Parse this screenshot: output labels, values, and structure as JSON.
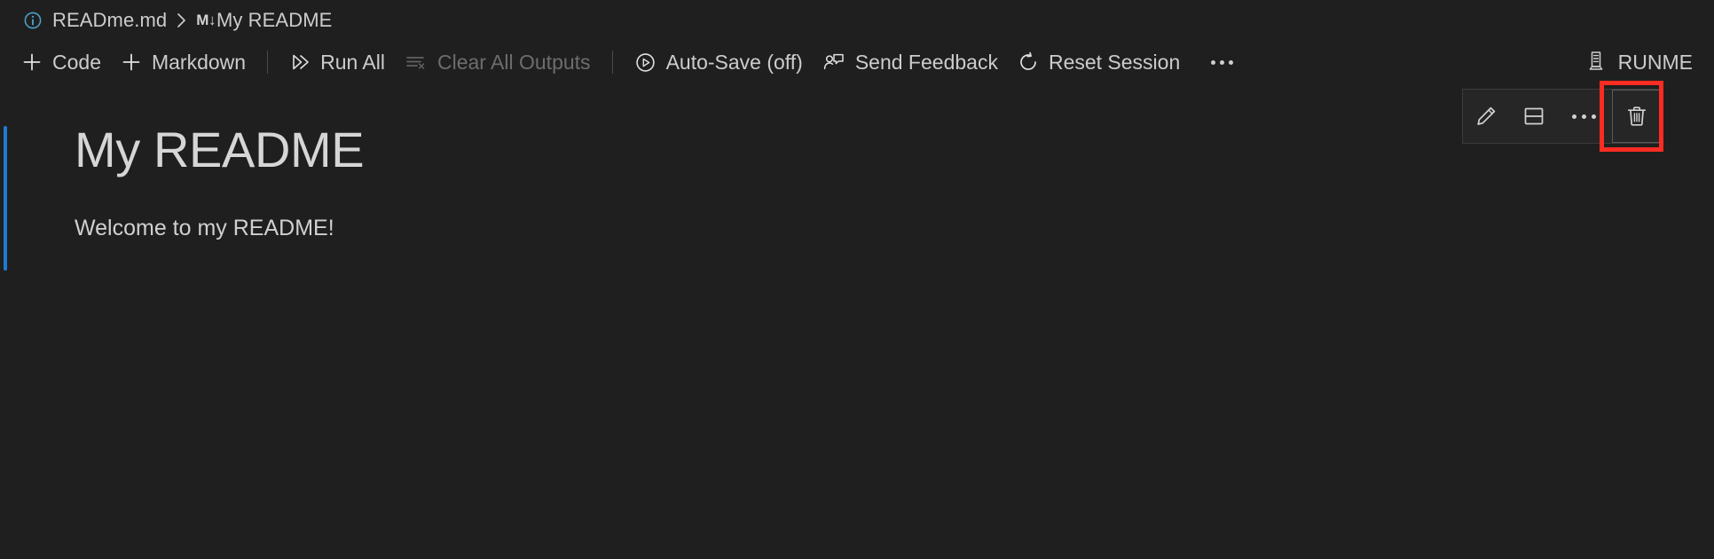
{
  "breadcrumb": {
    "info_icon": "info-icon",
    "file": "READme.md",
    "separator": "›",
    "markdown_icon_letter": "M",
    "markdown_icon_arrow": "↓",
    "heading": "My README"
  },
  "toolbar": {
    "add_code": {
      "label": "Code",
      "icon": "plus-icon"
    },
    "add_markdown": {
      "label": "Markdown",
      "icon": "plus-icon"
    },
    "run_all": {
      "label": "Run All",
      "icon": "run-all-icon"
    },
    "clear_all_outputs": {
      "label": "Clear All Outputs",
      "icon": "clear-outputs-icon",
      "disabled": true
    },
    "auto_save": {
      "label": "Auto-Save (off)",
      "icon": "play-circle-icon"
    },
    "send_feedback": {
      "label": "Send Feedback",
      "icon": "feedback-icon"
    },
    "reset_session": {
      "label": "Reset Session",
      "icon": "refresh-icon"
    },
    "overflow": {
      "label": "…",
      "icon": "ellipsis-icon"
    },
    "kernel": {
      "label": "RUNME",
      "icon": "server-icon"
    }
  },
  "cell": {
    "heading": "My README",
    "paragraph": "Welcome to my README!",
    "accent_color": "#1f7ad4",
    "toolbar": {
      "edit": {
        "name": "edit-cell-button",
        "icon": "pencil-icon"
      },
      "split": {
        "name": "split-cell-button",
        "icon": "split-cell-icon"
      },
      "more": {
        "name": "cell-more-button",
        "icon": "ellipsis-icon"
      },
      "delete": {
        "name": "delete-cell-button",
        "icon": "trash-icon"
      }
    }
  },
  "annotation": {
    "highlight_color": "#fb2c21",
    "target": "delete-cell-button"
  },
  "colors": {
    "background": "#1f1f1f",
    "text": "#cccccc",
    "disabled_text": "#6d6d6d",
    "accent_blue": "#1f7ad4",
    "info_blue": "#4a9ec9",
    "highlight_red": "#fb2c21"
  }
}
